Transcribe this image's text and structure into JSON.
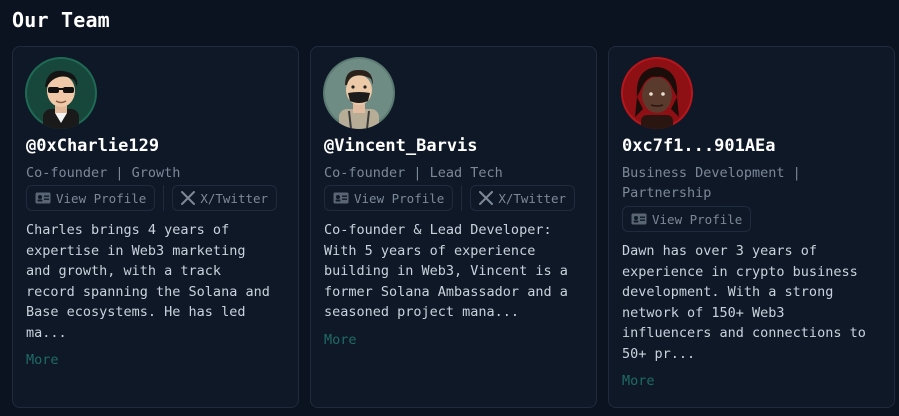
{
  "page": {
    "title": "Our Team"
  },
  "members": [
    {
      "handle": "@0xCharlie129",
      "role": "Co-founder | Growth",
      "view_profile_label": "View Profile",
      "twitter_label": "X/Twitter",
      "description": "Charles brings 4 years of\nexpertise in Web3 marketing\nand growth, with a track\nrecord spanning the Solana and\nBase ecosystems. He has led\nma...",
      "more_label": "More",
      "colors": {
        "avatar_bg": "#1f6a55"
      }
    },
    {
      "handle": "@Vincent_Barvis",
      "role": "Co-founder | Lead Tech",
      "view_profile_label": "View Profile",
      "twitter_label": "X/Twitter",
      "description": "Co-founder & Lead Developer:\nWith 5 years of experience\nbuilding in Web3, Vincent is a\nformer Solana Ambassador and a\nseasoned project mana...",
      "more_label": "More",
      "colors": {
        "avatar_bg": "#5a7a72"
      }
    },
    {
      "handle": "0xc7f1...901AEa",
      "role": "Business Development |\nPartnership",
      "view_profile_label": "View Profile",
      "description": "Dawn has over 3 years of\nexperience in crypto business\ndevelopment. With a strong\nnetwork of 150+ Web3\ninfluencers and connections to\n50+ pr...",
      "more_label": "More",
      "colors": {
        "avatar_bg": "#b5171c"
      }
    }
  ],
  "icons": {
    "profile": "id-card-icon",
    "twitter": "x-logo-icon"
  },
  "colors": {
    "background": "#0b1320",
    "card": "#0f1827",
    "border": "#1f2b3d",
    "muted_text": "#7c8898",
    "more_link": "#1e6b66"
  }
}
